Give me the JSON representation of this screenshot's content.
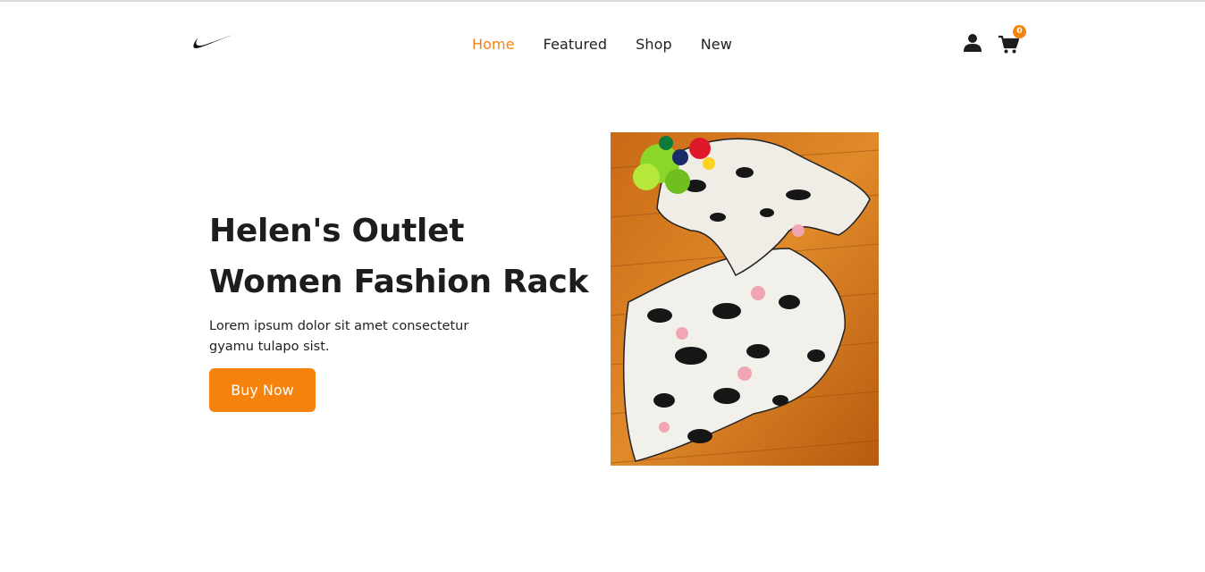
{
  "header": {
    "logo_icon": "swoosh-logo",
    "nav": [
      {
        "label": "Home",
        "active": true
      },
      {
        "label": "Featured",
        "active": false
      },
      {
        "label": "Shop",
        "active": false
      },
      {
        "label": "New",
        "active": false
      }
    ],
    "user_icon": "user-icon",
    "cart_icon": "cart-icon",
    "cart_count": "0"
  },
  "hero": {
    "title_line1": "Helen's Outlet",
    "title_line2": "Women Fashion Rack",
    "description": "Lorem ipsum dolor sit amet consectetur gyamu tulapo sist.",
    "button_label": "Buy Now",
    "image_subject": "cow-print satin pajama set on wooden floor with flowers"
  },
  "colors": {
    "accent": "#f5820d",
    "text": "#1d1d1f",
    "background": "#ffffff"
  }
}
